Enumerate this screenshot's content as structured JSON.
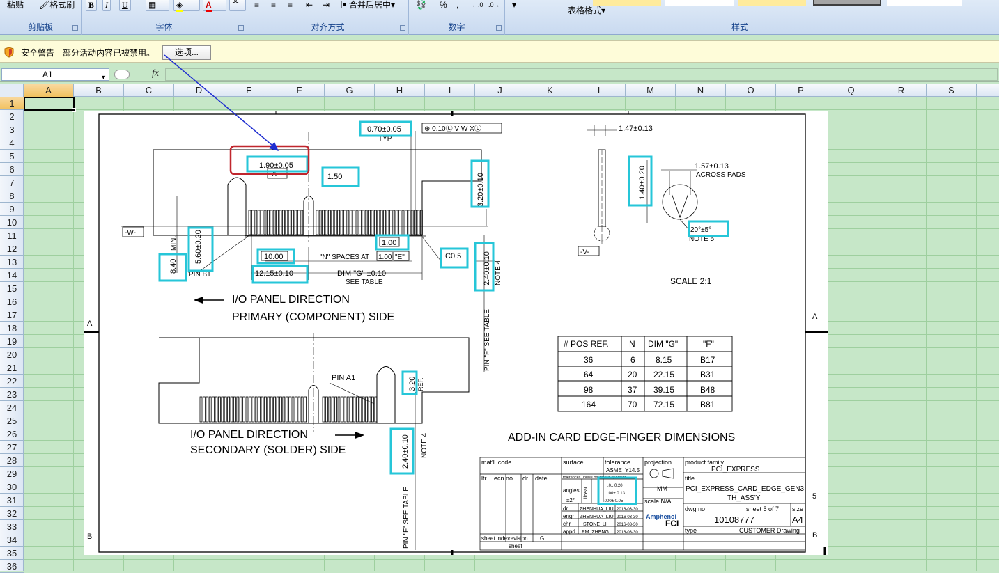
{
  "ribbon": {
    "clipboard": {
      "label": "剪贴板",
      "paste_label": "粘贴",
      "format_painter": "格式刷"
    },
    "font": {
      "label": "字体",
      "bold": "B",
      "italic": "I",
      "underline": "U",
      "color_letter": "A",
      "wen": "wén\n文"
    },
    "alignment": {
      "label": "对齐方式",
      "merge_center": "合并后居中"
    },
    "number": {
      "label": "数字",
      "percent": "%",
      "comma": ",",
      "inc_dec": ".0 .00",
      "dec_dec": ".00 .0"
    },
    "styles": {
      "label": "样式",
      "table_format": "表格格式"
    }
  },
  "security_bar": {
    "title": "安全警告",
    "message": "部分活动内容已被禁用。",
    "options_button": "选项..."
  },
  "formula_bar": {
    "name_box": "A1",
    "fx_label": "fx",
    "formula": ""
  },
  "columns": [
    "A",
    "B",
    "C",
    "D",
    "E",
    "F",
    "G",
    "H",
    "I",
    "J",
    "K",
    "L",
    "M",
    "N",
    "O",
    "P",
    "Q",
    "R",
    "S"
  ],
  "rows": [
    "1",
    "2",
    "3",
    "4",
    "5",
    "6",
    "7",
    "8",
    "9",
    "10",
    "11",
    "12",
    "13",
    "14",
    "15",
    "16",
    "17",
    "18",
    "19",
    "20",
    "21",
    "22",
    "23",
    "24",
    "25",
    "26",
    "27",
    "28",
    "29",
    "30",
    "31",
    "32",
    "33",
    "34",
    "35",
    "36"
  ],
  "active_cell": "A1",
  "drawing": {
    "dims": {
      "d_070": "0.70±0.05",
      "typ": "TYP.",
      "fcf": "⊕ 0.10Ⓛ V W XⓁ",
      "d_190": "1.90±0.05",
      "x_label": "-X-",
      "d_150": "1.50",
      "d_320v": "3.20±0.10",
      "d_147": "1.47±0.13",
      "d_140v": "1.40±0.20",
      "d_157": "1.57±0.13",
      "across_pads": "ACROSS PADS",
      "angle": "20°±5°",
      "note5": "NOTE 5",
      "w_label": "-W-",
      "d_560v": "5.60±0.20",
      "min_label": "MIN.",
      "d_840v": "8.40",
      "pin_b1": "PIN B1",
      "d_1000": "10.00",
      "n_spaces": "\"N\" SPACES AT",
      "d_100a": "1.00",
      "e_label": "\"E\"",
      "d_100b": "1.00",
      "c05": "C0.5",
      "d_240v": "2.40±0.10",
      "note4": "NOTE 4",
      "d_1215": "12.15±0.10",
      "dim_g": "DIM \"G\" ±0.10",
      "see_table": "SEE TABLE",
      "pin_f_table": "PIN \"F\" SEE TABLE",
      "v_label": "-V-",
      "scale": "SCALE 2:1",
      "io_dir": "I/O PANEL DIRECTION",
      "primary": "PRIMARY (COMPONENT) SIDE",
      "secondary": "SECONDARY (SOLDER) SIDE",
      "pin_a1": "PIN A1",
      "d_320b": "3.20",
      "ref": "REF.",
      "d_240b": "2.40±0.10",
      "note4b": "NOTE 4",
      "pin_f_table_b": "PIN \"F\" SEE TABLE",
      "big_title": "ADD-IN CARD EDGE-FINGER DIMENSIONS",
      "zone_a": "A",
      "zone_b": "B",
      "zone_5": "5"
    },
    "table": {
      "headers": [
        "# POS REF.",
        "N",
        "DIM \"G\"",
        "\"F\""
      ],
      "rows": [
        [
          "36",
          "6",
          "8.15",
          "B17"
        ],
        [
          "64",
          "20",
          "22.15",
          "B31"
        ],
        [
          "98",
          "37",
          "39.15",
          "B48"
        ],
        [
          "164",
          "70",
          "72.15",
          "B81"
        ]
      ]
    },
    "title_block": {
      "matl_code": "mat'l. code",
      "surface": "surface",
      "tolerance": "tolerance",
      "asme": "ASME_Y14.5",
      "projection": "projection",
      "product_family": "product family",
      "pci_express": "PCI_EXPRESS",
      "ltr": "ltr",
      "ecn_no": "ecn no",
      "dr": "dr",
      "date": "date",
      "tol_note": "tolerances unless otherwise specified",
      "angles": "angles",
      "linear": "linear",
      "pm2": "±2°",
      "t1": ".0± 0.20",
      "t2": ".00± 0.13",
      "t3": ".000± 0.05",
      "mm": "MM",
      "scale_na": "scale N/A",
      "title_label": "title",
      "title_1": "PCI_EXPRESS_CARD_EDGE_GEN3",
      "title_2": "TH_ASS'Y",
      "dr_name": "ZHENHUA_LIU",
      "eng_name": "ZHENHUA_LIU",
      "chr_name": "STONE_LI",
      "appd_name": "PM_ZHENG",
      "date1": "2016-03-30",
      "date2": "2016-03-30",
      "date3": "2016-03-30",
      "date4": "2016-03-30",
      "dr_l": "dr",
      "engr_l": "engr",
      "chr_l": "chr",
      "appd_l": "appd",
      "amphenol": "Amphenol",
      "fci": "FCI",
      "dwg_no_label": "dwg no",
      "sheet_of": "sheet 5 of 7",
      "size_label": "size",
      "dwg_no": "10108777",
      "size": "A4",
      "type_label": "type",
      "type_value": "CUSTOMER Drawing",
      "sheet_index": "sheet index",
      "revision": "revision",
      "rev_sheet": "sheet",
      "rev_g": "G"
    }
  },
  "colors": {
    "highlight": "#26c6d8",
    "annotation_red": "#c0262d",
    "arrow": "#1f2ed0",
    "grid_bg": "#c6e7c8"
  }
}
